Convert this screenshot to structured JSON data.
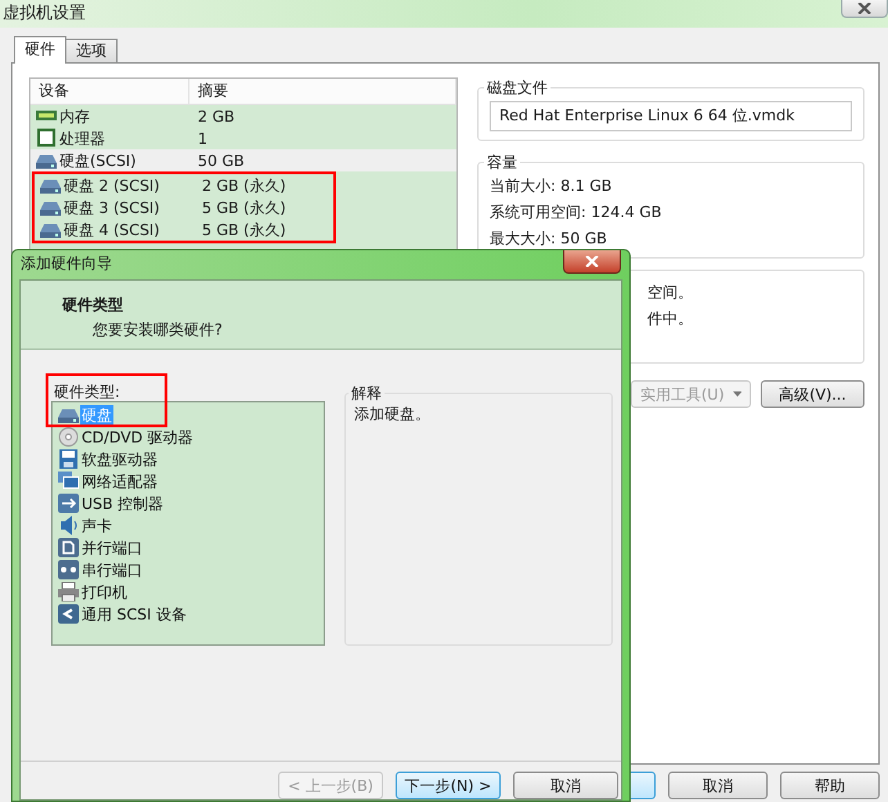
{
  "window": {
    "title": "虚拟机设置"
  },
  "tabs": [
    {
      "label": "硬件",
      "selected": true
    },
    {
      "label": "选项",
      "selected": false
    }
  ],
  "device_table": {
    "columns": [
      "设备",
      "摘要"
    ],
    "rows": [
      {
        "kind": "memory",
        "device": "内存",
        "summary": "2 GB",
        "selected": false,
        "highlighted": false
      },
      {
        "kind": "processor",
        "device": "处理器",
        "summary": "1",
        "selected": false,
        "highlighted": false
      },
      {
        "kind": "disk",
        "device": "硬盘(SCSI)",
        "summary": "50 GB",
        "selected": true,
        "highlighted": false
      },
      {
        "kind": "disk",
        "device": "硬盘 2 (SCSI)",
        "summary": "2 GB (永久)",
        "selected": false,
        "highlighted": true
      },
      {
        "kind": "disk",
        "device": "硬盘 3 (SCSI)",
        "summary": "5 GB (永久)",
        "selected": false,
        "highlighted": true
      },
      {
        "kind": "disk",
        "device": "硬盘 4 (SCSI)",
        "summary": "5 GB (永久)",
        "selected": false,
        "highlighted": true
      }
    ]
  },
  "disk_file": {
    "title": "磁盘文件",
    "value": "Red Hat Enterprise Linux 6 64 位.vmdk"
  },
  "capacity": {
    "title": "容量",
    "lines": [
      "当前大小: 8.1 GB",
      "系统可用空间: 124.4 GB",
      "最大大小: 50 GB"
    ]
  },
  "info_group": {
    "lines": [
      "空间。",
      "件中。"
    ]
  },
  "actions": [
    {
      "label": "实用工具(U)",
      "disabled": true,
      "dropdown": true
    },
    {
      "label": "高级(V)...",
      "disabled": false,
      "dropdown": false
    }
  ],
  "footer_buttons": [
    {
      "label": "取消"
    },
    {
      "label": "帮助"
    }
  ],
  "wizard": {
    "title": "添加硬件向导",
    "heading": "硬件类型",
    "subheading": "您要安装哪类硬件?",
    "list_label": "硬件类型:",
    "highlighted": true,
    "items": [
      {
        "kind": "disk",
        "label": "硬盘",
        "selected": true
      },
      {
        "kind": "cdrom",
        "label": "CD/DVD 驱动器",
        "selected": false
      },
      {
        "kind": "floppy",
        "label": "软盘驱动器",
        "selected": false
      },
      {
        "kind": "network",
        "label": "网络适配器",
        "selected": false
      },
      {
        "kind": "usb",
        "label": "USB 控制器",
        "selected": false
      },
      {
        "kind": "sound",
        "label": "声卡",
        "selected": false
      },
      {
        "kind": "parallel",
        "label": "并行端口",
        "selected": false
      },
      {
        "kind": "serial",
        "label": "串行端口",
        "selected": false
      },
      {
        "kind": "printer",
        "label": "打印机",
        "selected": false
      },
      {
        "kind": "scsi",
        "label": "通用 SCSI 设备",
        "selected": false
      }
    ],
    "explanation": {
      "title": "解释",
      "text": "添加硬盘。"
    },
    "buttons": [
      {
        "label": "< 上一步(B)",
        "disabled": true,
        "default": false
      },
      {
        "label": "下一步(N) >",
        "disabled": false,
        "default": true
      },
      {
        "label": "取消",
        "disabled": false,
        "default": false
      }
    ]
  }
}
